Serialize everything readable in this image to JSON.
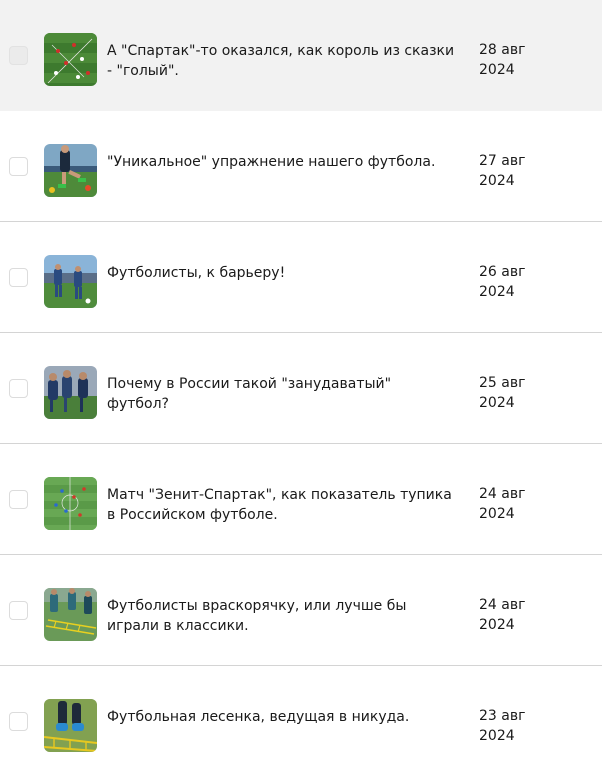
{
  "articles": [
    {
      "title": "А \"Спартак\"-то оказался, как король из сказки - \"голый\".",
      "date_day": "28 авг",
      "date_year": "2024",
      "thumbnail": "pitch-tactics-image"
    },
    {
      "title": "\"Уникальное\" упражнение нашего футбола.",
      "date_day": "27 авг",
      "date_year": "2024",
      "thumbnail": "training-drill-image"
    },
    {
      "title": "Футболисты, к барьеру!",
      "date_day": "26 авг",
      "date_year": "2024",
      "thumbnail": "players-stadium-image"
    },
    {
      "title": "Почему в России такой \"занудаватый\" футбол?",
      "date_day": "25 авг",
      "date_year": "2024",
      "thumbnail": "players-training-image"
    },
    {
      "title": "Матч \"Зенит-Спартак\", как показатель тупика в Российском футболе.",
      "date_day": "24 авг",
      "date_year": "2024",
      "thumbnail": "match-aerial-image"
    },
    {
      "title": "Футболисты враскорячку, или лучше бы играли в классики.",
      "date_day": "24 авг",
      "date_year": "2024",
      "thumbnail": "ladder-drill-image"
    },
    {
      "title": "Футбольная лесенка, ведущая в никуда.",
      "date_day": "23 авг",
      "date_year": "2024",
      "thumbnail": "agility-ladder-image"
    }
  ],
  "colors": {
    "hover_row": "#f2f2f2",
    "divider": "#d4d4d4",
    "text": "#1a1a1a"
  }
}
